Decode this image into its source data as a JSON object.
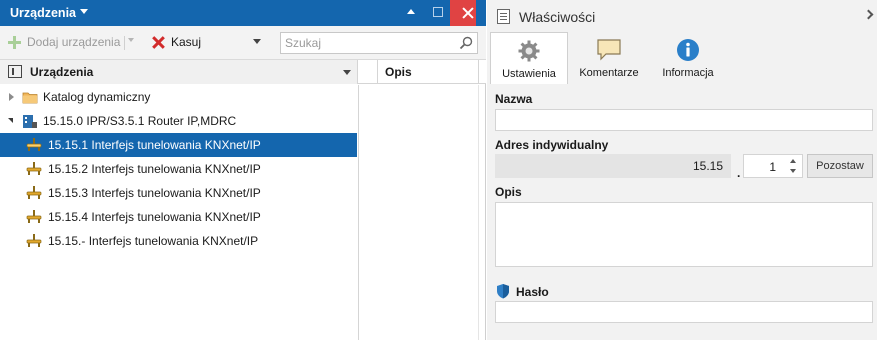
{
  "left_panel": {
    "title": "Urządzenia",
    "toolbar": {
      "add_label": "Dodaj urządzenia",
      "delete_label": "Kasuj",
      "search_placeholder": "Szukaj"
    },
    "columns": {
      "devices": "Urządzenia",
      "description": "Opis"
    },
    "tree": [
      {
        "label": "Katalog dynamiczny",
        "level": 0,
        "expander": "closed",
        "icon": "folder-icon",
        "selected": false
      },
      {
        "label": "15.15.0 IPR/S3.5.1 Router IP,MDRC",
        "level": 0,
        "expander": "open",
        "icon": "router-device-icon",
        "selected": false
      },
      {
        "label": "15.15.1 Interfejs tunelowania KNXnet/IP",
        "level": 1,
        "expander": "none",
        "icon": "tunnel-interface-icon",
        "selected": true
      },
      {
        "label": "15.15.2 Interfejs tunelowania KNXnet/IP",
        "level": 1,
        "expander": "none",
        "icon": "tunnel-interface-icon",
        "selected": false
      },
      {
        "label": "15.15.3 Interfejs tunelowania KNXnet/IP",
        "level": 1,
        "expander": "none",
        "icon": "tunnel-interface-icon",
        "selected": false
      },
      {
        "label": "15.15.4 Interfejs tunelowania KNXnet/IP",
        "level": 1,
        "expander": "none",
        "icon": "tunnel-interface-icon",
        "selected": false
      },
      {
        "label": "15.15.- Interfejs tunelowania KNXnet/IP",
        "level": 1,
        "expander": "none",
        "icon": "tunnel-interface-icon",
        "selected": false
      }
    ]
  },
  "right_panel": {
    "title": "Właściwości",
    "tabs": [
      {
        "label": "Ustawienia",
        "icon": "gear-icon",
        "active": true
      },
      {
        "label": "Komentarze",
        "icon": "comment-icon",
        "active": false
      },
      {
        "label": "Informacja",
        "icon": "info-icon",
        "active": false
      }
    ],
    "form": {
      "name_label": "Nazwa",
      "name_value": "",
      "address_label": "Adres indywidualny",
      "address_prefix": "15.15",
      "address_separator": ".",
      "address_number": "1",
      "keep_button": "Pozostaw",
      "description_label": "Opis",
      "description_value": "",
      "password_label": "Hasło",
      "password_value": ""
    }
  },
  "colors": {
    "accent": "#1466ae",
    "close": "#e04343",
    "delete": "#d22b2b",
    "add_disabled": "#a9cf98",
    "panel_bg": "#f2f2f2"
  }
}
